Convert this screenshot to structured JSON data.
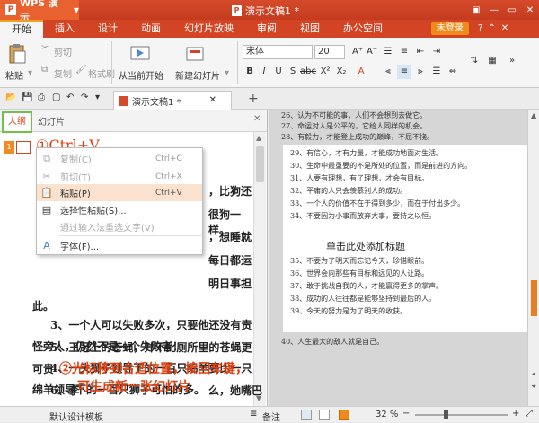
{
  "titlebar": {
    "app_name": "WPS 演示",
    "doc_title": "演示文稿1 *"
  },
  "menubar": {
    "tabs": [
      "开始",
      "插入",
      "设计",
      "动画",
      "幻灯片放映",
      "审阅",
      "视图",
      "办公空间"
    ],
    "active": "开始",
    "login": "未登录"
  },
  "ribbon": {
    "paste": "粘贴",
    "cut": "剪切",
    "copy": "复制",
    "format_painter": "格式刷",
    "from_current": "从当前开始",
    "new_slide": "新建幻灯片",
    "font_name": "宋体",
    "font_size": "20"
  },
  "doctab": {
    "title": "演示文稿1 *"
  },
  "panel": {
    "outline_tab": "大纲",
    "slides_tab": "幻灯片",
    "slide_number": "1"
  },
  "annotations": {
    "step1": "①Ctrl+V",
    "step2_line1": "②光标移到合适位置，按回车键，",
    "step2_line2": "可生成新一张幻灯片"
  },
  "outline_fragments": {
    "r1": "，比狗还",
    "r2": "很狗一样。",
    "r3": "，想睡就",
    "r4": "每日都运",
    "r5": "明日事担",
    "l6": "此。",
    "line7": "3、一个人可以失败多次，只要他还没有责",
    "line8": "怪旁人，仍然不是一个失败者！",
    "line9": "4、一头狮子领导下的一百只绵羊要比一只",
    "line10": "绵羊领导下的一百只狮子可怕的多。",
    "line11": "5、王冠上的苍蝇，并不比厕所里的苍蝇更",
    "line12a": "可贵",
    "line13a": "6、李",
    "line13b": "么，她嘴巴"
  },
  "context_menu": {
    "items": [
      {
        "label": "复制(C)",
        "shortcut": "Ctrl+C",
        "disabled": true,
        "icon": "copy-icon"
      },
      {
        "label": "剪切(T)",
        "shortcut": "Ctrl+X",
        "disabled": true,
        "icon": "scissors-icon"
      },
      {
        "label": "粘贴(P)",
        "shortcut": "Ctrl+V",
        "disabled": false,
        "icon": "paste-icon"
      },
      {
        "label": "选择性粘贴(S)...",
        "shortcut": "",
        "disabled": false,
        "icon": "paste-special-icon"
      },
      {
        "label": "通过输入法重选文字(V)",
        "shortcut": "",
        "disabled": true,
        "icon": ""
      },
      {
        "label": "字体(F)...",
        "shortcut": "",
        "disabled": false,
        "icon": "font-icon"
      }
    ]
  },
  "slide_preview": {
    "title_placeholder": "单击此处添加标题",
    "lines": [
      "26、认为不可能的事，人们不会想到去做它。",
      "27、命运对人是公平的，它给人同样的机会。",
      "28、有毅力，才能登上成功的巅峰，不屈不挠。",
      "29、有信心，才有力量，才能成功地面对生活。",
      "30、生命中最重要的不是所处的位置，而是前进的方向。",
      "31、人要有理想，有了理想，才会有目标。",
      "32、平庸的人只会羡慕别人的成功。",
      "33、一个人的价值不在于得到多少，而在于付出多少。",
      "34、不要因为小事而放弃大事，要持之以恒。",
      "35、不要为了明天而忘记今天，珍惜眼前。",
      "36、世界会向那些有目标和远见的人让路。",
      "37、敢于挑战自我的人，才能赢得更多的掌声。",
      "38、成功的人往往都是能够坚持到最后的人。",
      "39、今天的努力是为了明天的收获。",
      "40、人生最大的敌人就是自己。"
    ]
  },
  "statusbar": {
    "template": "默认设计模板",
    "notes": "备注",
    "zoom": "32 %"
  }
}
